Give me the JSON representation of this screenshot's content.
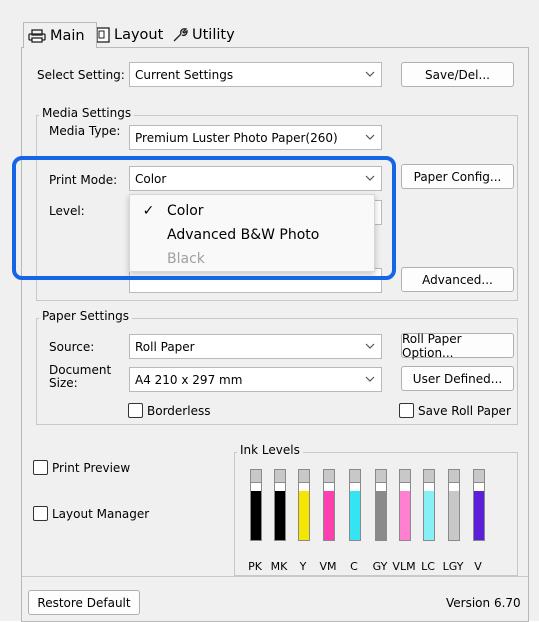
{
  "tabs": [
    {
      "label": "Main",
      "icon": "printer-icon"
    },
    {
      "label": "Layout",
      "icon": "layout-icon"
    },
    {
      "label": "Utility",
      "icon": "wrench-icon"
    }
  ],
  "select_setting": {
    "label": "Select Setting:",
    "value": "Current Settings",
    "save_button": "Save/Del..."
  },
  "media_settings": {
    "legend": "Media Settings",
    "media_type_label": "Media Type:",
    "media_type_value": "Premium Luster Photo Paper(260)",
    "print_mode_label": "Print Mode:",
    "print_mode_value": "Color",
    "paper_config_button": "Paper Config...",
    "level_label": "Level:",
    "advanced_button": "Advanced...",
    "dropdown_options": [
      {
        "label": "Color",
        "checked": true,
        "disabled": false
      },
      {
        "label": "Advanced B&W Photo",
        "checked": false,
        "disabled": false
      },
      {
        "label": "Black",
        "checked": false,
        "disabled": true
      }
    ],
    "check_glyph": "✓"
  },
  "paper_settings": {
    "legend": "Paper Settings",
    "source_label": "Source:",
    "source_value": "Roll Paper",
    "roll_paper_option_button": "Roll Paper Option...",
    "document_size_label_line1": "Document",
    "document_size_label_line2": "Size:",
    "document_size_value": "A4 210 x 297 mm",
    "user_defined_button": "User Defined...",
    "borderless_label": "Borderless",
    "save_roll_paper_label": "Save Roll Paper"
  },
  "options": {
    "print_preview_label": "Print Preview",
    "layout_manager_label": "Layout Manager"
  },
  "ink_levels": {
    "legend": "Ink Levels",
    "inks": [
      {
        "code": "PK",
        "color": "#000000",
        "level": 0.85
      },
      {
        "code": "MK",
        "color": "#000000",
        "level": 0.85
      },
      {
        "code": "Y",
        "color": "#f4e600",
        "level": 0.85
      },
      {
        "code": "VM",
        "color": "#ff3fb0",
        "level": 0.85
      },
      {
        "code": "C",
        "color": "#34e4f0",
        "level": 0.85
      },
      {
        "code": "GY",
        "color": "#8a8a8a",
        "level": 0.85
      },
      {
        "code": "VLM",
        "color": "#ff7fd0",
        "level": 0.85
      },
      {
        "code": "LC",
        "color": "#86f0f6",
        "level": 0.85
      },
      {
        "code": "LGY",
        "color": "#c8c8c8",
        "level": 0.85
      },
      {
        "code": "V",
        "color": "#5a1fd6",
        "level": 0.85
      }
    ]
  },
  "footer": {
    "restore_default_button": "Restore Default",
    "version": "Version 6.70"
  },
  "accent_color": "#1565e6"
}
